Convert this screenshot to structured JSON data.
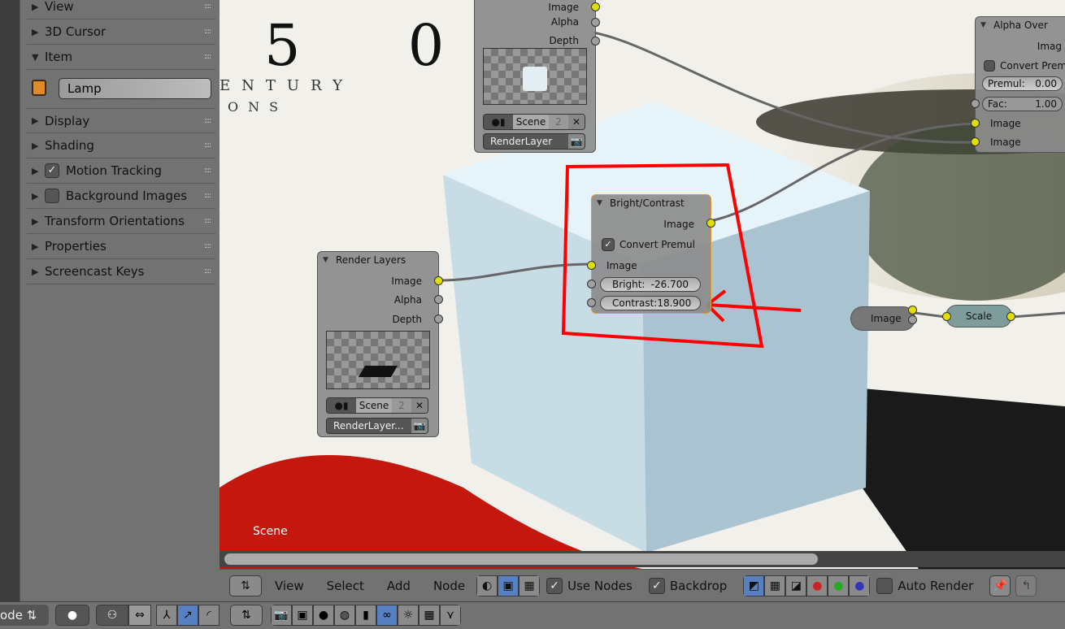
{
  "panel": {
    "items": [
      {
        "label": "View",
        "state": "collapsed"
      },
      {
        "label": "3D Cursor",
        "state": "collapsed"
      },
      {
        "label": "Item",
        "state": "expanded"
      },
      {
        "label": "Display",
        "state": "collapsed"
      },
      {
        "label": "Shading",
        "state": "collapsed"
      },
      {
        "label": "Motion Tracking",
        "state": "collapsed",
        "checked": true
      },
      {
        "label": "Background Images",
        "state": "collapsed",
        "checked": false
      },
      {
        "label": "Transform Orientations",
        "state": "collapsed"
      },
      {
        "label": "Properties",
        "state": "collapsed"
      },
      {
        "label": "Screencast Keys",
        "state": "collapsed"
      }
    ],
    "item_name": "Lamp"
  },
  "backdrop": {
    "text_big": "5 0",
    "text_line1": "ENTURY",
    "text_line2": "ONS",
    "scene_label": "Scene"
  },
  "nodes": {
    "render_layers_top": {
      "outputs": [
        "Image",
        "Alpha",
        "Depth"
      ],
      "scene": "Scene",
      "users": "2",
      "layer": "RenderLayer"
    },
    "bright_contrast": {
      "title": "Bright/Contrast",
      "output": "Image",
      "convert_premul": "Convert Premul",
      "input": "Image",
      "bright_label": "Bright:",
      "bright": "-26.700",
      "contrast_label": "Contrast:",
      "contrast": "18.900"
    },
    "render_layers": {
      "title": "Render Layers",
      "outputs": [
        "Image",
        "Alpha",
        "Depth"
      ],
      "scene": "Scene",
      "users": "2",
      "layer": "RenderLayer..."
    },
    "alpha_over": {
      "title": "Alpha Over",
      "output": "Imag",
      "convert_premul": "Convert Prem",
      "premul_label": "Premul:",
      "premul": "0.00",
      "fac_label": "Fac:",
      "fac": "1.00",
      "inputs": [
        "Image",
        "Image"
      ]
    },
    "image": {
      "label": "Image"
    },
    "scale": {
      "label": "Scale"
    }
  },
  "header": {
    "menus": [
      "View",
      "Select",
      "Add",
      "Node"
    ],
    "use_nodes": "Use Nodes",
    "backdrop": "Backdrop",
    "auto_render": "Auto Render"
  },
  "view3d_header": {
    "mode": "ode"
  },
  "annotation_color": "#ff0000"
}
